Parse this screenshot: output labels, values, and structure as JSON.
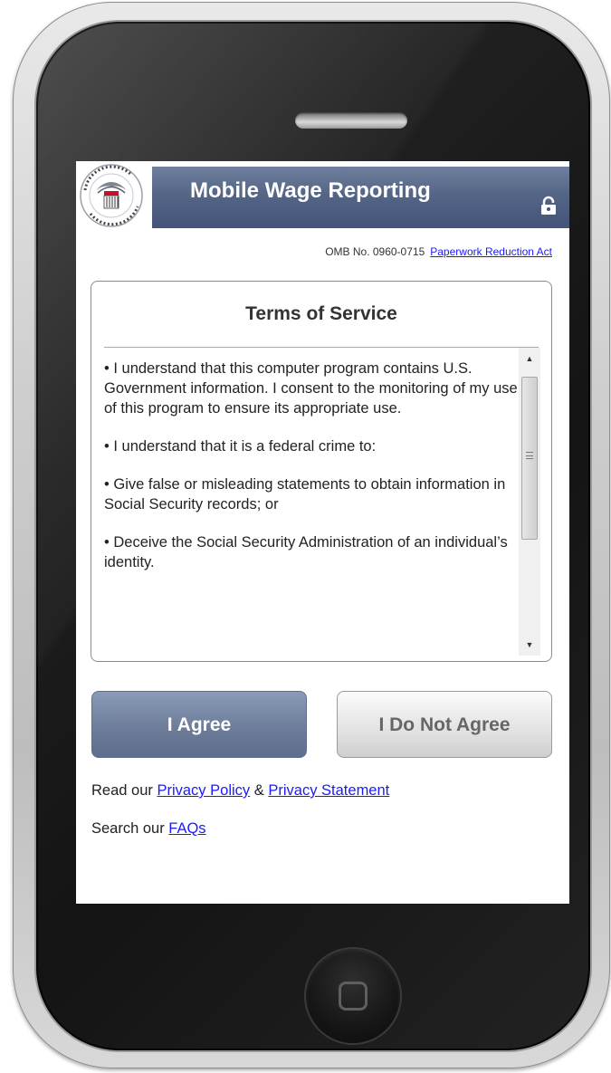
{
  "header": {
    "logo_text": "SOCIAL SECURITY ADMINISTRATION USA",
    "title": "Mobile Wage Reporting",
    "lock_icon": "lock-icon",
    "brand_color": "#556585"
  },
  "omb": {
    "number_text": "OMB No. 0960-0715",
    "link_label": "Paperwork Reduction Act"
  },
  "terms": {
    "title": "Terms of Service",
    "paragraphs": [
      "• I understand that this computer program contains U.S. Government information. I consent to the monitoring of my use of this program to ensure its appropriate use.",
      "• I understand that it is a federal crime to:",
      "• Give false or misleading statements to obtain information in Social Security records; or",
      "• Deceive the Social Security Administration of an individual’s identity."
    ]
  },
  "buttons": {
    "agree_label": "I Agree",
    "disagree_label": "I Do Not Agree",
    "agree_color": "#6d7d9a"
  },
  "footer": {
    "read_prefix": "Read our ",
    "privacy_policy_label": "Privacy Policy",
    "ampersand": " & ",
    "privacy_statement_label": "Privacy Statement",
    "search_prefix": "Search our ",
    "faqs_label": "FAQs",
    "link_color": "#1a1aff"
  }
}
